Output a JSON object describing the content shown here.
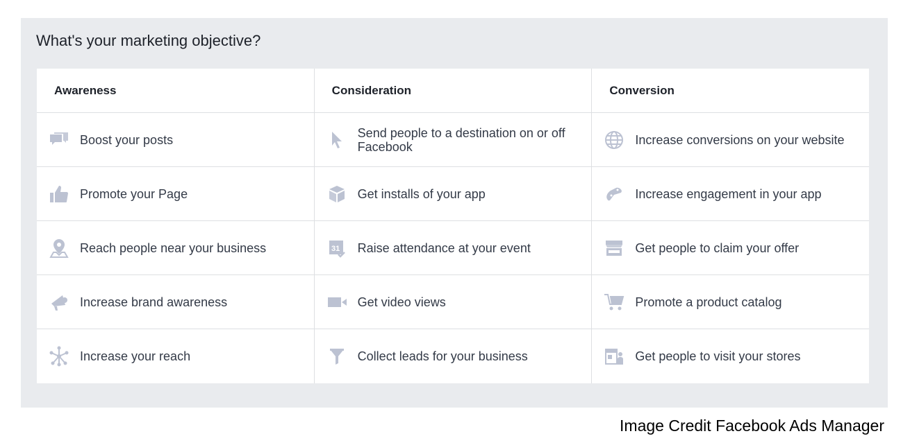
{
  "title": "What's your marketing objective?",
  "columns": [
    {
      "header": "Awareness",
      "items": [
        {
          "label": "Boost your posts",
          "icon": "speech-bubbles-icon"
        },
        {
          "label": "Promote your Page",
          "icon": "thumbs-up-icon"
        },
        {
          "label": "Reach people near your business",
          "icon": "map-pin-icon"
        },
        {
          "label": "Increase brand awareness",
          "icon": "megaphone-icon"
        },
        {
          "label": "Increase your reach",
          "icon": "network-burst-icon"
        }
      ]
    },
    {
      "header": "Consideration",
      "items": [
        {
          "label": "Send people to a destination on or off Facebook",
          "icon": "cursor-arrow-icon"
        },
        {
          "label": "Get installs of your app",
          "icon": "package-box-icon"
        },
        {
          "label": "Raise attendance at your event",
          "icon": "calendar-icon"
        },
        {
          "label": "Get video views",
          "icon": "video-camera-icon"
        },
        {
          "label": "Collect leads for your business",
          "icon": "funnel-icon"
        }
      ]
    },
    {
      "header": "Conversion",
      "items": [
        {
          "label": "Increase conversions on your website",
          "icon": "globe-icon"
        },
        {
          "label": "Increase engagement in your app",
          "icon": "game-controller-icon"
        },
        {
          "label": "Get people to claim your offer",
          "icon": "storefront-icon"
        },
        {
          "label": "Promote a product catalog",
          "icon": "shopping-cart-icon"
        },
        {
          "label": "Get people to visit your stores",
          "icon": "store-visit-icon"
        }
      ]
    }
  ],
  "credit": "Image Credit Facebook Ads Manager",
  "colors": {
    "icon": "#bcc2d2",
    "panel": "#e9ebee",
    "text": "#333a47"
  }
}
